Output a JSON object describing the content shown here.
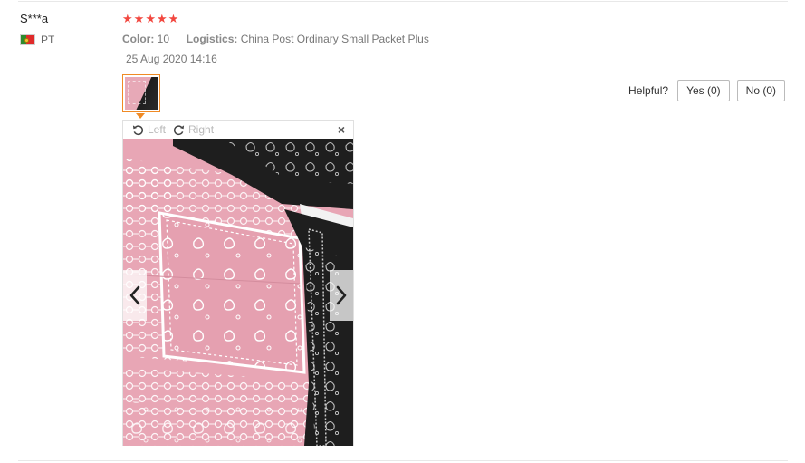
{
  "review": {
    "user_name": "S***a",
    "country_code": "PT",
    "rating": 5,
    "stars": [
      "★",
      "★",
      "★",
      "★",
      "★"
    ],
    "color_label": "Color:",
    "color_value": "10",
    "logistics_label": "Logistics:",
    "logistics_value": "China Post Ordinary Small Packet Plus",
    "date": "25 Aug 2020 14:16"
  },
  "helpful": {
    "label": "Helpful?",
    "yes_label": "Yes (0)",
    "no_label": "No (0)"
  },
  "viewer": {
    "rotate_left_label": "Left",
    "rotate_right_label": "Right",
    "close_glyph": "×"
  },
  "colors": {
    "star": "#f2473f",
    "thumb_border": "#f08a24",
    "bandana_pink": "#e8a6b5",
    "bandana_black": "#1e1e1e"
  },
  "icons": [
    "flag-portugal-icon",
    "rotate-left-icon",
    "rotate-right-icon",
    "close-icon",
    "chevron-left-icon",
    "chevron-right-icon"
  ]
}
